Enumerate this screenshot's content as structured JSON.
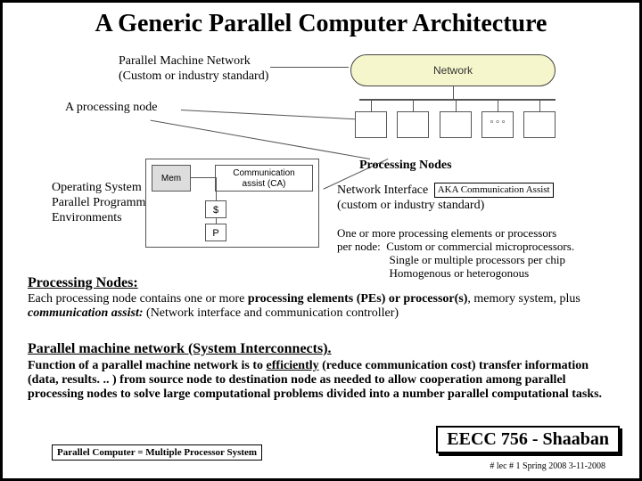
{
  "title": "A Generic Parallel Computer Architecture",
  "caption1": "Parallel Machine Network\n(Custom or industry standard)",
  "caption2": "A processing node",
  "caption3": "Operating System\nParallel Programming\nEnvironments",
  "procnodes_label": "Processing Nodes",
  "diagram": {
    "network_label": "Network",
    "mem": "Mem",
    "ca": "Communication\nassist (CA)",
    "cache": "$",
    "proc": "P",
    "dots": "° ° °"
  },
  "netif": {
    "line1": "Network Interface",
    "aka": "AKA Communication Assist",
    "line2": "(custom or industry standard)"
  },
  "desc1": "One or more processing elements or processors\nper node:  Custom or commercial microprocessors.\n                  Single or multiple processors per chip\n                  Homogenous or heterogonous",
  "procnodes_h": "Processing Nodes:",
  "body1_a": "Each processing node contains one or more ",
  "body1_b": "processing elements (PEs) or processor(s)",
  "body1_c": ", memory system, plus ",
  "body1_d": "communication assist:",
  "body1_e": "  (Network interface and communication controller)",
  "pmn_h": "Parallel machine network (System Interconnects).",
  "body2": "Function of a parallel machine network is to efficiently (reduce communication cost) transfer information (data, results. . . ) from source node to destination node as needed to allow cooperation among parallel processing nodes to solve large computational problems divided into a number parallel computational tasks.",
  "foot_left": "Parallel Computer = Multiple Processor System",
  "foot_right": "EECC 756 - Shaaban",
  "footnote": "#  lec # 1     Spring 2008   3-11-2008"
}
